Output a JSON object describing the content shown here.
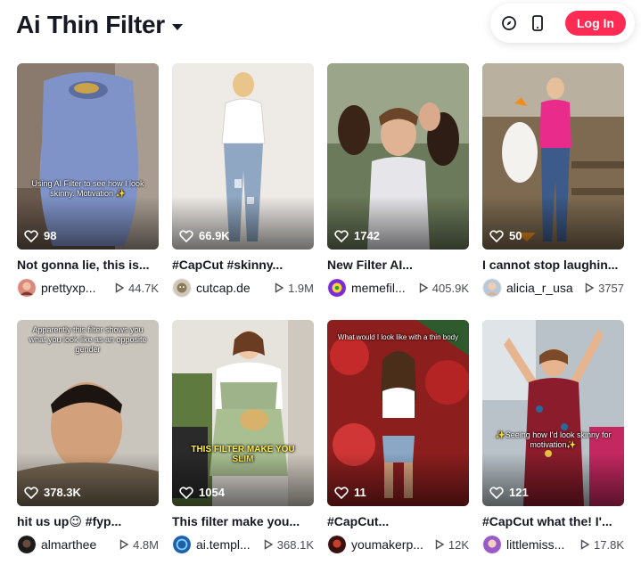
{
  "header": {
    "title": "Ai Thin Filter",
    "login_label": "Log In",
    "icons": [
      "caret-down-icon",
      "compass-icon",
      "mobile-icon"
    ]
  },
  "colors": {
    "brand": "#fe2c55",
    "text": "#161823",
    "muted": "#4b4c55"
  },
  "videos": [
    {
      "likes": "98",
      "description": "Not gonna lie, this is...",
      "username": "prettyxp...",
      "plays": "44.7K",
      "overlay": "Using AI Filter to see how I look skinny. Motivation ✨"
    },
    {
      "likes": "66.9K",
      "description": "#CapCut #skinny...",
      "username": "cutcap.de",
      "plays": "1.9M"
    },
    {
      "likes": "1742",
      "description": "New Filter AI...",
      "username": "memefil...",
      "plays": "405.9K"
    },
    {
      "likes": "50",
      "description": "I cannot stop laughin...",
      "username": "alicia_r_usa",
      "plays": "3757"
    },
    {
      "likes": "378.3K",
      "description": "hit us up😉 #fyp...",
      "username": "almarthee",
      "plays": "4.8M",
      "overlay": "Apparently this filter shows you what you look like as an opposite gender"
    },
    {
      "likes": "1054",
      "description": "This filter make you...",
      "username": "ai.templ...",
      "plays": "368.1K",
      "overlay": "THIS FILTER MAKE YOU SLIM"
    },
    {
      "likes": "11",
      "description": "#CapCut...",
      "username": "youmakerp...",
      "plays": "12K",
      "overlay": "What would I look like with a thin body"
    },
    {
      "likes": "121",
      "description": "#CapCut what the! I'...",
      "username": "littlemiss...",
      "plays": "17.8K",
      "overlay": "✨Seeing how I'd look skinny for motivation✨"
    }
  ]
}
